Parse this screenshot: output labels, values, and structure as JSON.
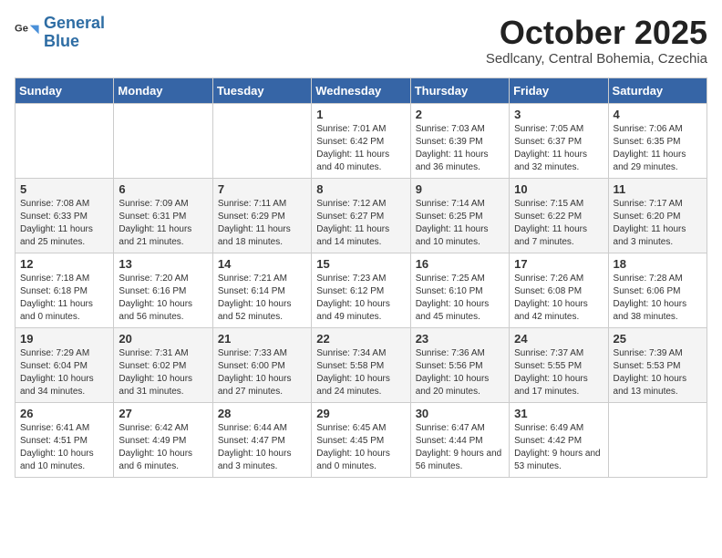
{
  "header": {
    "logo_line1": "General",
    "logo_line2": "Blue",
    "month": "October 2025",
    "location": "Sedlcany, Central Bohemia, Czechia"
  },
  "weekdays": [
    "Sunday",
    "Monday",
    "Tuesday",
    "Wednesday",
    "Thursday",
    "Friday",
    "Saturday"
  ],
  "weeks": [
    [
      {
        "day": "",
        "info": ""
      },
      {
        "day": "",
        "info": ""
      },
      {
        "day": "",
        "info": ""
      },
      {
        "day": "1",
        "info": "Sunrise: 7:01 AM\nSunset: 6:42 PM\nDaylight: 11 hours\nand 40 minutes."
      },
      {
        "day": "2",
        "info": "Sunrise: 7:03 AM\nSunset: 6:39 PM\nDaylight: 11 hours\nand 36 minutes."
      },
      {
        "day": "3",
        "info": "Sunrise: 7:05 AM\nSunset: 6:37 PM\nDaylight: 11 hours\nand 32 minutes."
      },
      {
        "day": "4",
        "info": "Sunrise: 7:06 AM\nSunset: 6:35 PM\nDaylight: 11 hours\nand 29 minutes."
      }
    ],
    [
      {
        "day": "5",
        "info": "Sunrise: 7:08 AM\nSunset: 6:33 PM\nDaylight: 11 hours\nand 25 minutes."
      },
      {
        "day": "6",
        "info": "Sunrise: 7:09 AM\nSunset: 6:31 PM\nDaylight: 11 hours\nand 21 minutes."
      },
      {
        "day": "7",
        "info": "Sunrise: 7:11 AM\nSunset: 6:29 PM\nDaylight: 11 hours\nand 18 minutes."
      },
      {
        "day": "8",
        "info": "Sunrise: 7:12 AM\nSunset: 6:27 PM\nDaylight: 11 hours\nand 14 minutes."
      },
      {
        "day": "9",
        "info": "Sunrise: 7:14 AM\nSunset: 6:25 PM\nDaylight: 11 hours\nand 10 minutes."
      },
      {
        "day": "10",
        "info": "Sunrise: 7:15 AM\nSunset: 6:22 PM\nDaylight: 11 hours\nand 7 minutes."
      },
      {
        "day": "11",
        "info": "Sunrise: 7:17 AM\nSunset: 6:20 PM\nDaylight: 11 hours\nand 3 minutes."
      }
    ],
    [
      {
        "day": "12",
        "info": "Sunrise: 7:18 AM\nSunset: 6:18 PM\nDaylight: 11 hours\nand 0 minutes."
      },
      {
        "day": "13",
        "info": "Sunrise: 7:20 AM\nSunset: 6:16 PM\nDaylight: 10 hours\nand 56 minutes."
      },
      {
        "day": "14",
        "info": "Sunrise: 7:21 AM\nSunset: 6:14 PM\nDaylight: 10 hours\nand 52 minutes."
      },
      {
        "day": "15",
        "info": "Sunrise: 7:23 AM\nSunset: 6:12 PM\nDaylight: 10 hours\nand 49 minutes."
      },
      {
        "day": "16",
        "info": "Sunrise: 7:25 AM\nSunset: 6:10 PM\nDaylight: 10 hours\nand 45 minutes."
      },
      {
        "day": "17",
        "info": "Sunrise: 7:26 AM\nSunset: 6:08 PM\nDaylight: 10 hours\nand 42 minutes."
      },
      {
        "day": "18",
        "info": "Sunrise: 7:28 AM\nSunset: 6:06 PM\nDaylight: 10 hours\nand 38 minutes."
      }
    ],
    [
      {
        "day": "19",
        "info": "Sunrise: 7:29 AM\nSunset: 6:04 PM\nDaylight: 10 hours\nand 34 minutes."
      },
      {
        "day": "20",
        "info": "Sunrise: 7:31 AM\nSunset: 6:02 PM\nDaylight: 10 hours\nand 31 minutes."
      },
      {
        "day": "21",
        "info": "Sunrise: 7:33 AM\nSunset: 6:00 PM\nDaylight: 10 hours\nand 27 minutes."
      },
      {
        "day": "22",
        "info": "Sunrise: 7:34 AM\nSunset: 5:58 PM\nDaylight: 10 hours\nand 24 minutes."
      },
      {
        "day": "23",
        "info": "Sunrise: 7:36 AM\nSunset: 5:56 PM\nDaylight: 10 hours\nand 20 minutes."
      },
      {
        "day": "24",
        "info": "Sunrise: 7:37 AM\nSunset: 5:55 PM\nDaylight: 10 hours\nand 17 minutes."
      },
      {
        "day": "25",
        "info": "Sunrise: 7:39 AM\nSunset: 5:53 PM\nDaylight: 10 hours\nand 13 minutes."
      }
    ],
    [
      {
        "day": "26",
        "info": "Sunrise: 6:41 AM\nSunset: 4:51 PM\nDaylight: 10 hours\nand 10 minutes."
      },
      {
        "day": "27",
        "info": "Sunrise: 6:42 AM\nSunset: 4:49 PM\nDaylight: 10 hours\nand 6 minutes."
      },
      {
        "day": "28",
        "info": "Sunrise: 6:44 AM\nSunset: 4:47 PM\nDaylight: 10 hours\nand 3 minutes."
      },
      {
        "day": "29",
        "info": "Sunrise: 6:45 AM\nSunset: 4:45 PM\nDaylight: 10 hours\nand 0 minutes."
      },
      {
        "day": "30",
        "info": "Sunrise: 6:47 AM\nSunset: 4:44 PM\nDaylight: 9 hours\nand 56 minutes."
      },
      {
        "day": "31",
        "info": "Sunrise: 6:49 AM\nSunset: 4:42 PM\nDaylight: 9 hours\nand 53 minutes."
      },
      {
        "day": "",
        "info": ""
      }
    ]
  ]
}
